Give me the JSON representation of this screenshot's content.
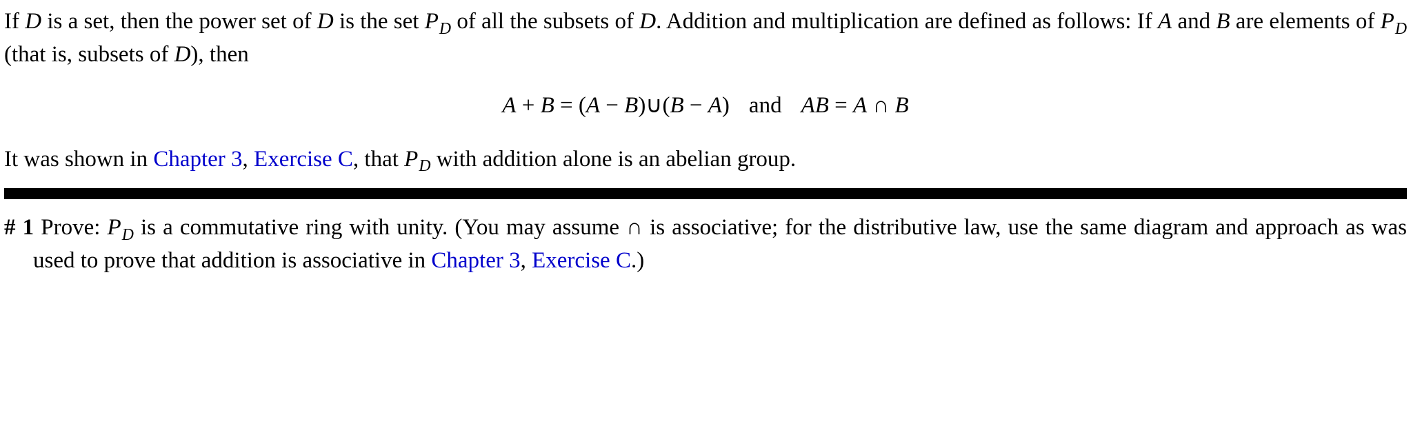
{
  "intro": {
    "t1": "If ",
    "D1": "D",
    "t2": " is a set, then the power set of ",
    "D2": "D",
    "t3": " is the set ",
    "P1": "P",
    "Dsub1": "D",
    "t4": " of all the subsets of ",
    "D3": "D",
    "t5": ". Addition and multiplication are defined as follows: If ",
    "A1": "A",
    "t6": " and ",
    "B1": "B",
    "t7": " are elements of ",
    "P2": "P",
    "Dsub2": "D",
    "t8": " (that is, subsets of ",
    "D4": "D",
    "t9": "), then"
  },
  "equation": {
    "lhs1a": "A",
    "plus": " + ",
    "lhs1b": "B",
    "eq1": " = (",
    "A2": "A",
    "minus1": " − ",
    "B2": "B",
    "mid": ")∪(",
    "B3": "B",
    "minus2": " − ",
    "A3": "A",
    "close": ")",
    "and": "and",
    "lhs2": "AB",
    "eq2": " = ",
    "A4": "A",
    "cap": " ∩ ",
    "B4": "B"
  },
  "after": {
    "t1": "It was shown in ",
    "link1": "Chapter 3",
    "comma": ", ",
    "link2": "Exercise C",
    "t2": ", that ",
    "P3": "P",
    "Dsub3": "D",
    "t3": " with addition alone is an abelian group."
  },
  "exercise": {
    "hash": "# ",
    "num": "1",
    "t1": " Prove: ",
    "P4": "P",
    "Dsub4": "D",
    "t2": " is a commutative ring with unity. (You may assume ∩ is associative; for the distributive law, use the same diagram and approach as was used to prove that addition is associative in ",
    "link3": "Chapter 3",
    "comma2": ", ",
    "link4": "Exercise C",
    "t3": ".)"
  }
}
